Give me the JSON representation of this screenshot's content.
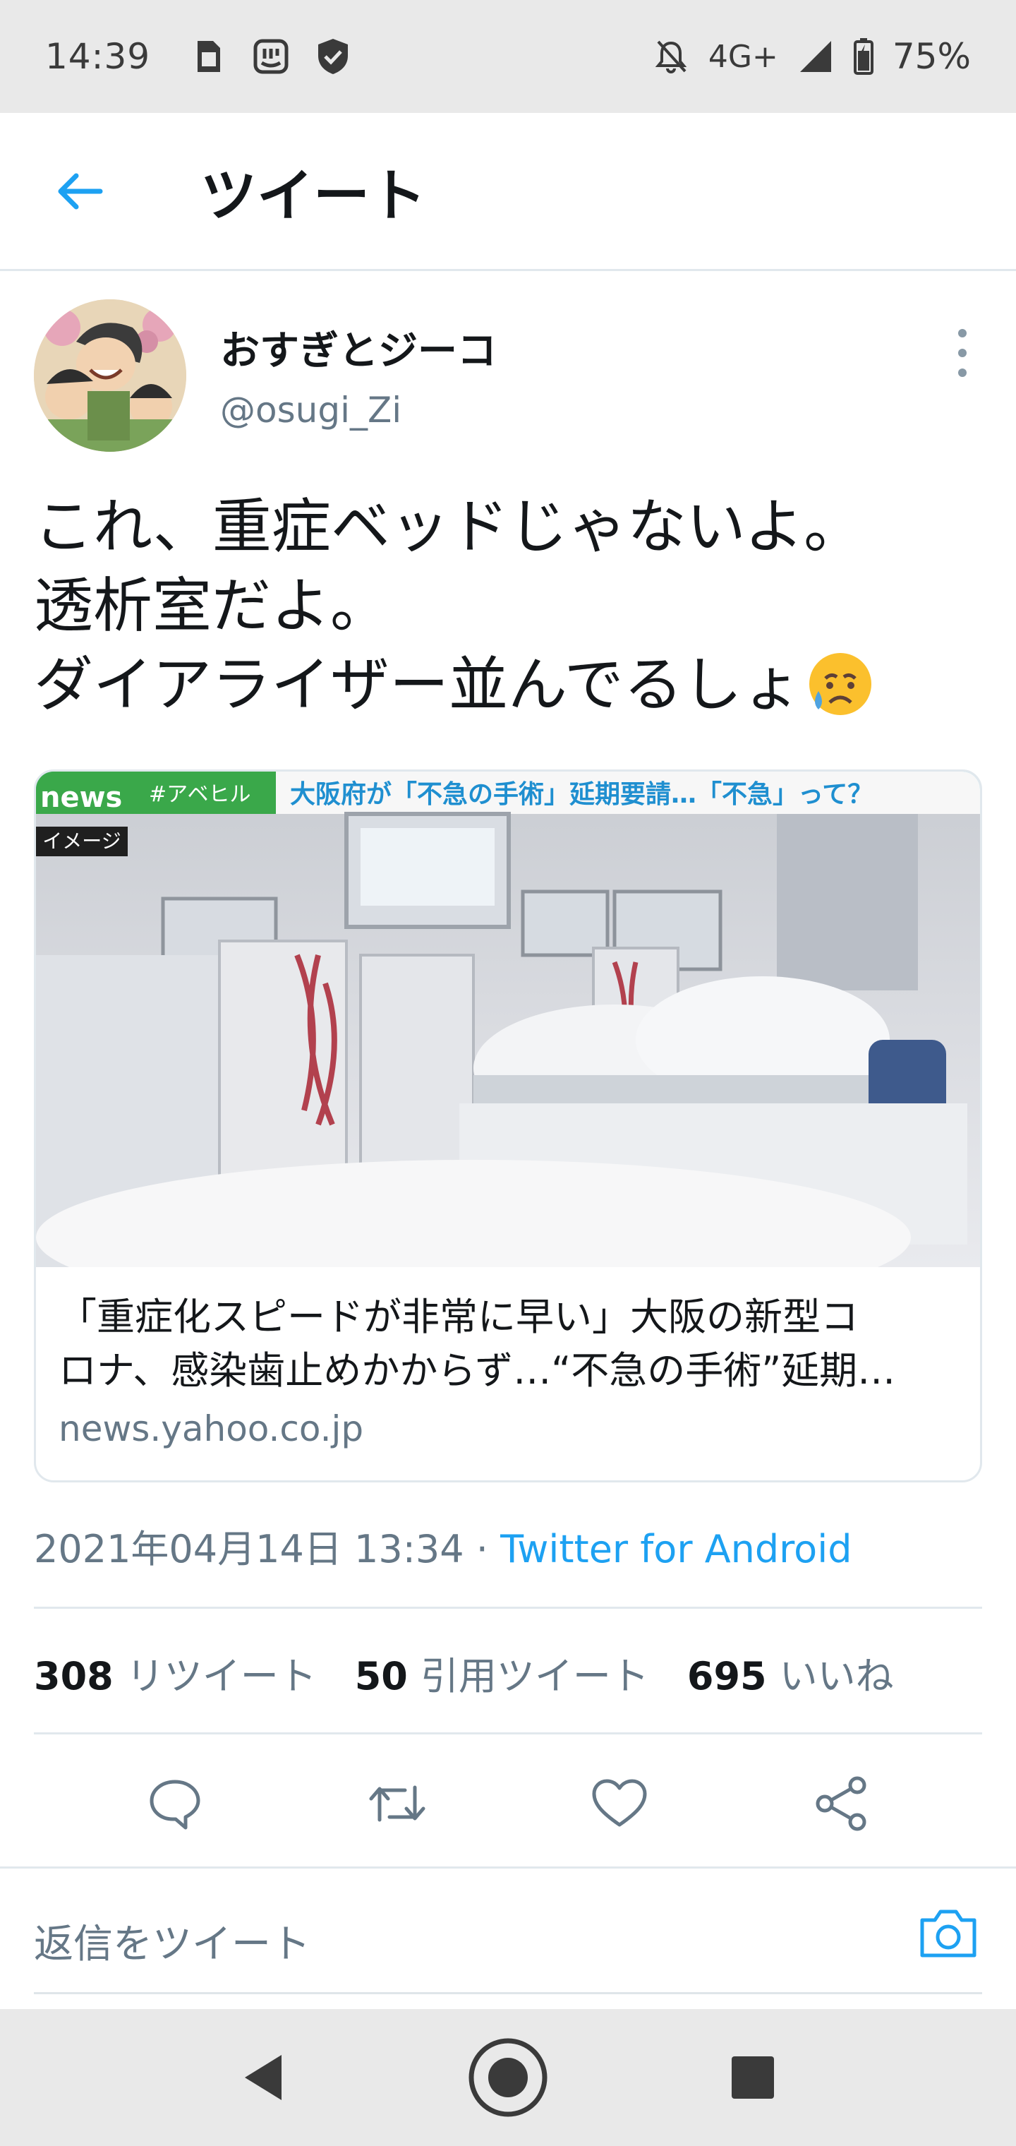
{
  "status_bar": {
    "time": "14:39",
    "network": "4G+",
    "battery": "75%",
    "icons": [
      "sim-card-icon",
      "messenger-icon",
      "shield-icon",
      "notifications-off-icon",
      "signal-icon",
      "battery-icon"
    ]
  },
  "header": {
    "title": "ツイート",
    "back_icon": "arrow-left-icon"
  },
  "tweet": {
    "author_name": "おすぎとジーコ",
    "handle": "@osugi_Zi",
    "text_lines": [
      "これ、重症ベッドじゃないよ。",
      "透析室だよ。",
      "ダイアライザー並んでるしょ"
    ],
    "emoji": "sad-relieved-face-emoji",
    "card": {
      "image_banner": "大阪府が「不急の手術」延期要請…「不急」って？",
      "image_hashtag": "#アベヒル",
      "image_logo": "news",
      "image_tag": "イメージ",
      "title_lines": [
        "「重症化スピードが非常に早い」大阪の新型コ",
        "ロナ、感染歯止めかからず…“不急の手術”延期…"
      ],
      "domain": "news.yahoo.co.jp"
    },
    "timestamp": "2021年04月14日 13:34",
    "separator": " · ",
    "source": "Twitter for Android",
    "stats": {
      "retweets_count": "308",
      "retweets_label": "リツイート",
      "quotes_count": "50",
      "quotes_label": "引用ツイート",
      "likes_count": "695",
      "likes_label": "いいね"
    },
    "actions": [
      "reply-icon",
      "retweet-icon",
      "like-icon",
      "share-icon"
    ]
  },
  "reply": {
    "placeholder": "返信をツイート",
    "camera_icon": "camera-icon"
  },
  "navbar": [
    "back-nav-icon",
    "home-nav-icon",
    "recents-nav-icon"
  ],
  "colors": {
    "accent": "#1da1f2",
    "secondary_text": "#657786",
    "border": "#e1e8ed",
    "system_bar": "#e9e9e9"
  }
}
